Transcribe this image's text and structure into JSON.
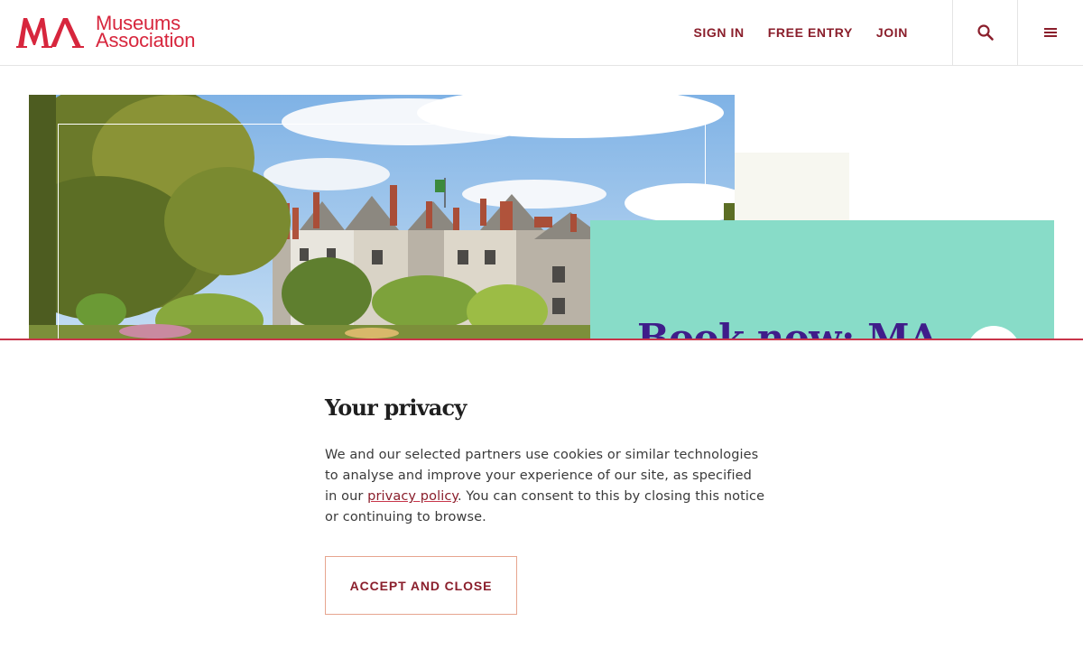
{
  "header": {
    "logo": {
      "line1": "Museums",
      "line2": "Association",
      "mark": "MA"
    },
    "nav": [
      {
        "label": "SIGN IN"
      },
      {
        "label": "FREE ENTRY"
      },
      {
        "label": "JOIN"
      }
    ],
    "search_icon": "search-icon",
    "menu_icon": "hamburger-menu-icon"
  },
  "hero": {
    "image_alt": "Historic stone manor house with chimneys and flag, surrounded by trees and gardens under a blue sky",
    "card_title": "Book now: MA"
  },
  "privacy": {
    "title": "Your privacy",
    "body_before": "We and our selected partners use cookies or similar technologies to analyse and improve your experience of our site, as specified in our ",
    "link_text": "privacy policy",
    "body_after": ". You can consent to this by closing this notice or continuing to browse.",
    "button_label": "ACCEPT AND CLOSE"
  },
  "colors": {
    "brand_red": "#d7263d",
    "nav_text": "#8a1e2b",
    "teal": "#88dcc8",
    "purple": "#3f1d8a",
    "banner_border": "#c8354a"
  }
}
